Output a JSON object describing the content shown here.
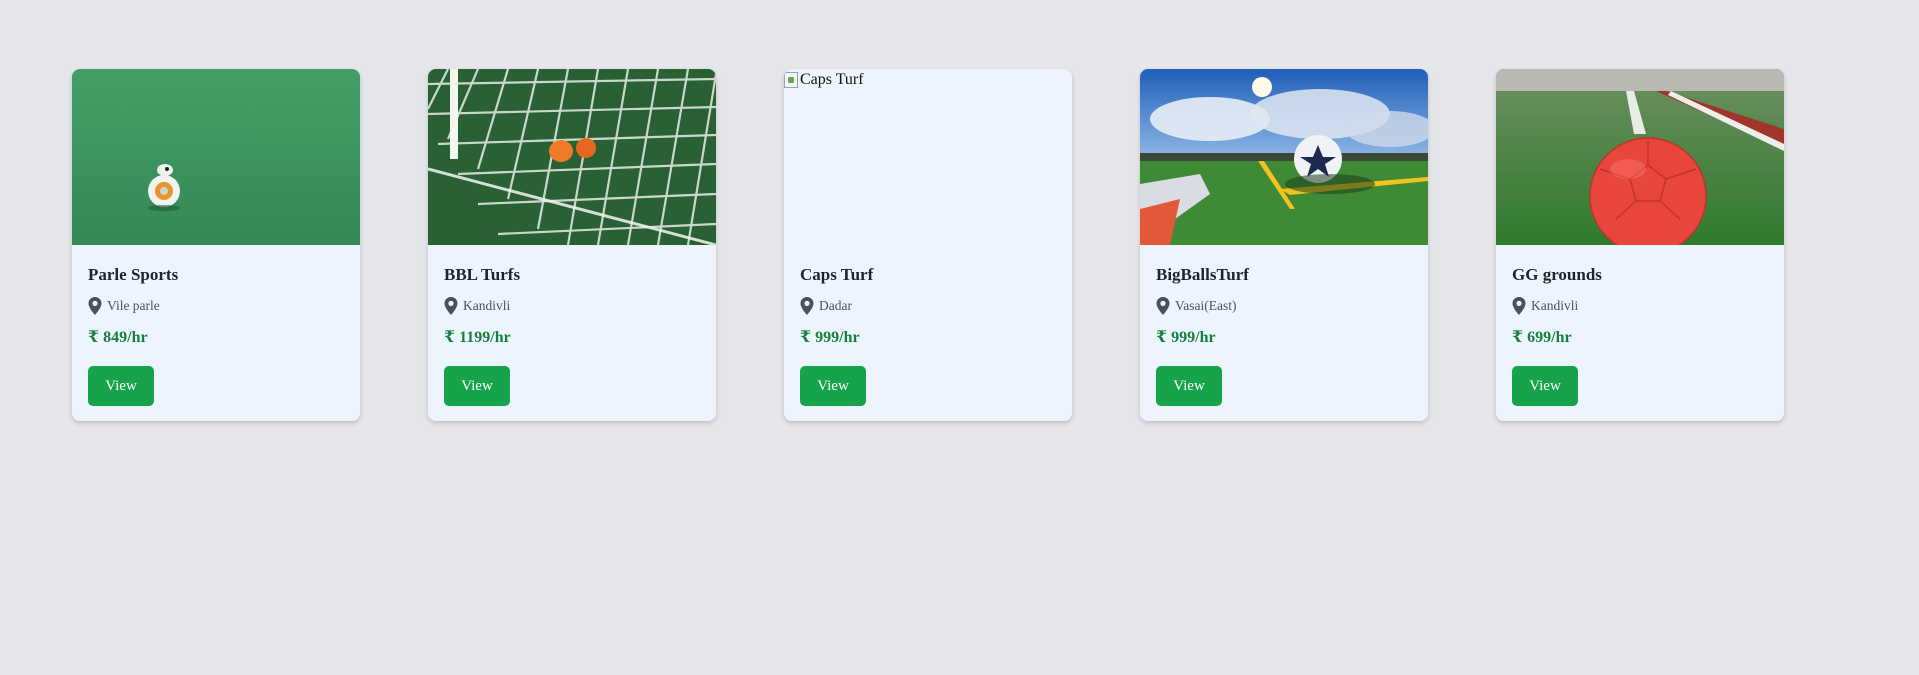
{
  "cards": [
    {
      "name": "Parle Sports",
      "location": "Vile parle",
      "price": "₹ 849/hr",
      "button_label": "View",
      "image_kind": "turf-ball-robot"
    },
    {
      "name": "BBL Turfs",
      "location": "Kandivli",
      "price": "₹ 1199/hr",
      "button_label": "View",
      "image_kind": "goal-net"
    },
    {
      "name": "Caps Turf",
      "location": "Dadar",
      "price": "₹ 999/hr",
      "button_label": "View",
      "image_alt": "Caps Turf",
      "image_kind": "broken"
    },
    {
      "name": "BigBallsTurf",
      "location": "Vasai(East)",
      "price": "₹ 999/hr",
      "button_label": "View",
      "image_kind": "sky-field-ball"
    },
    {
      "name": "GG grounds",
      "location": "Kandivli",
      "price": "₹ 699/hr",
      "button_label": "View",
      "image_kind": "red-ball"
    }
  ],
  "colors": {
    "background": "#e6e7ea",
    "card": "#eef4fd",
    "button": "#16a34a",
    "price": "#15803d"
  },
  "icons": {
    "location": "map-pin-icon"
  }
}
